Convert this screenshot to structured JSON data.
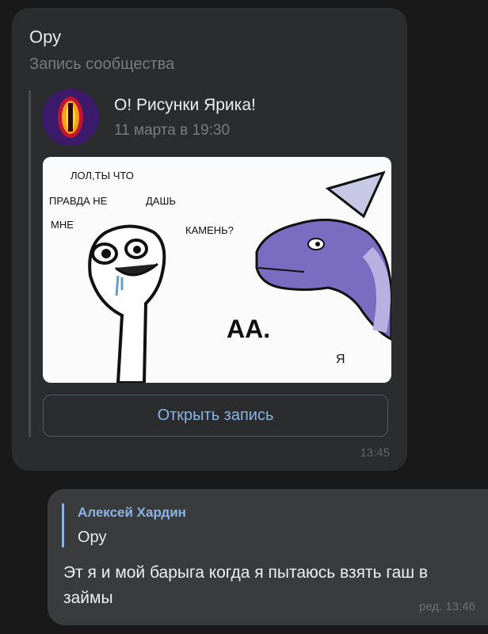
{
  "incoming": {
    "text": "Ору",
    "subtitle": "Запись сообщества",
    "post": {
      "author": "О! Рисунки Ярика!",
      "date": "11 марта в 19:30",
      "image": {
        "speech_lines": [
          "ЛОЛ,ТЫ ЧТО",
          "ПРАВДА НЕ",
          "ДАШЬ",
          "МНЕ",
          "КАМЕНЬ?"
        ],
        "reply_text": "АА.",
        "signature": "Я"
      }
    },
    "open_button_label": "Открыть запись",
    "time": "13:45"
  },
  "outgoing": {
    "reply_author": "Алексей Хардин",
    "reply_text": "Ору",
    "text": "Эт я и мой барыга когда я пытаюсь взять гаш в займы",
    "time": "ред. 13:46"
  },
  "colors": {
    "background": "#19191a",
    "incoming_bubble": "#2b2c2e",
    "outgoing_bubble": "#3a3b3d",
    "accent": "#8ab4e8"
  }
}
